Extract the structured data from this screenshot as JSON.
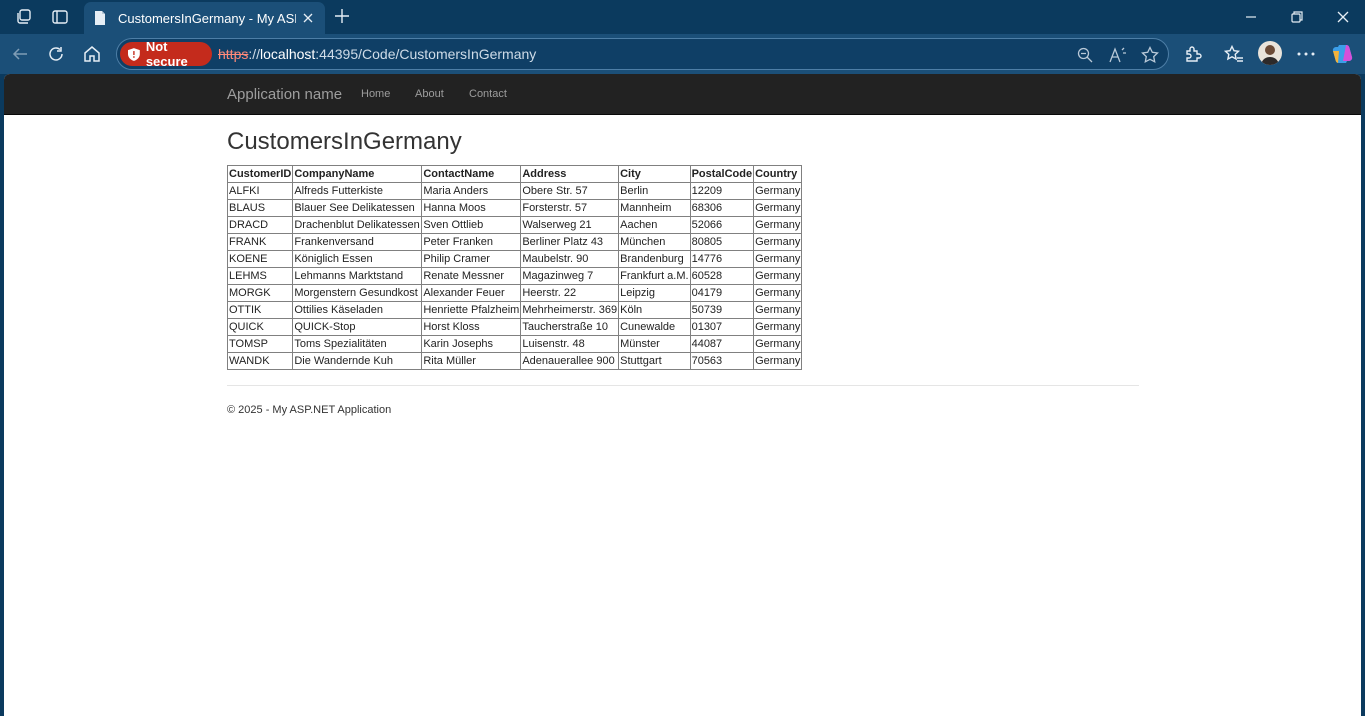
{
  "browser": {
    "tab_title": "CustomersInGermany - My ASP.NET Application",
    "security_label": "Not secure",
    "url_scheme": "https",
    "url_sep": "://",
    "url_host": "localhost",
    "url_port_path": ":44395/Code/CustomersInGermany",
    "accent_color": "#c42b1c",
    "frame_color": "#0b3a5e"
  },
  "navbar": {
    "brand": "Application name",
    "links": [
      "Home",
      "About",
      "Contact"
    ]
  },
  "page": {
    "title": "CustomersInGermany",
    "footer": "© 2025 - My ASP.NET Application"
  },
  "table": {
    "headers": [
      "CustomerID",
      "CompanyName",
      "ContactName",
      "Address",
      "City",
      "PostalCode",
      "Country"
    ],
    "rows": [
      [
        "ALFKI",
        "Alfreds Futterkiste",
        "Maria Anders",
        "Obere Str. 57",
        "Berlin",
        "12209",
        "Germany"
      ],
      [
        "BLAUS",
        "Blauer See Delikatessen",
        "Hanna Moos",
        "Forsterstr. 57",
        "Mannheim",
        "68306",
        "Germany"
      ],
      [
        "DRACD",
        "Drachenblut Delikatessen",
        "Sven Ottlieb",
        "Walserweg 21",
        "Aachen",
        "52066",
        "Germany"
      ],
      [
        "FRANK",
        "Frankenversand",
        "Peter Franken",
        "Berliner Platz 43",
        "München",
        "80805",
        "Germany"
      ],
      [
        "KOENE",
        "Königlich Essen",
        "Philip Cramer",
        "Maubelstr. 90",
        "Brandenburg",
        "14776",
        "Germany"
      ],
      [
        "LEHMS",
        "Lehmanns Marktstand",
        "Renate Messner",
        "Magazinweg 7",
        "Frankfurt a.M.",
        "60528",
        "Germany"
      ],
      [
        "MORGK",
        "Morgenstern Gesundkost",
        "Alexander Feuer",
        "Heerstr. 22",
        "Leipzig",
        "04179",
        "Germany"
      ],
      [
        "OTTIK",
        "Ottilies Käseladen",
        "Henriette Pfalzheim",
        "Mehrheimerstr. 369",
        "Köln",
        "50739",
        "Germany"
      ],
      [
        "QUICK",
        "QUICK-Stop",
        "Horst Kloss",
        "Taucherstraße 10",
        "Cunewalde",
        "01307",
        "Germany"
      ],
      [
        "TOMSP",
        "Toms Spezialitäten",
        "Karin Josephs",
        "Luisenstr. 48",
        "Münster",
        "44087",
        "Germany"
      ],
      [
        "WANDK",
        "Die Wandernde Kuh",
        "Rita Müller",
        "Adenauerallee 900",
        "Stuttgart",
        "70563",
        "Germany"
      ]
    ]
  }
}
